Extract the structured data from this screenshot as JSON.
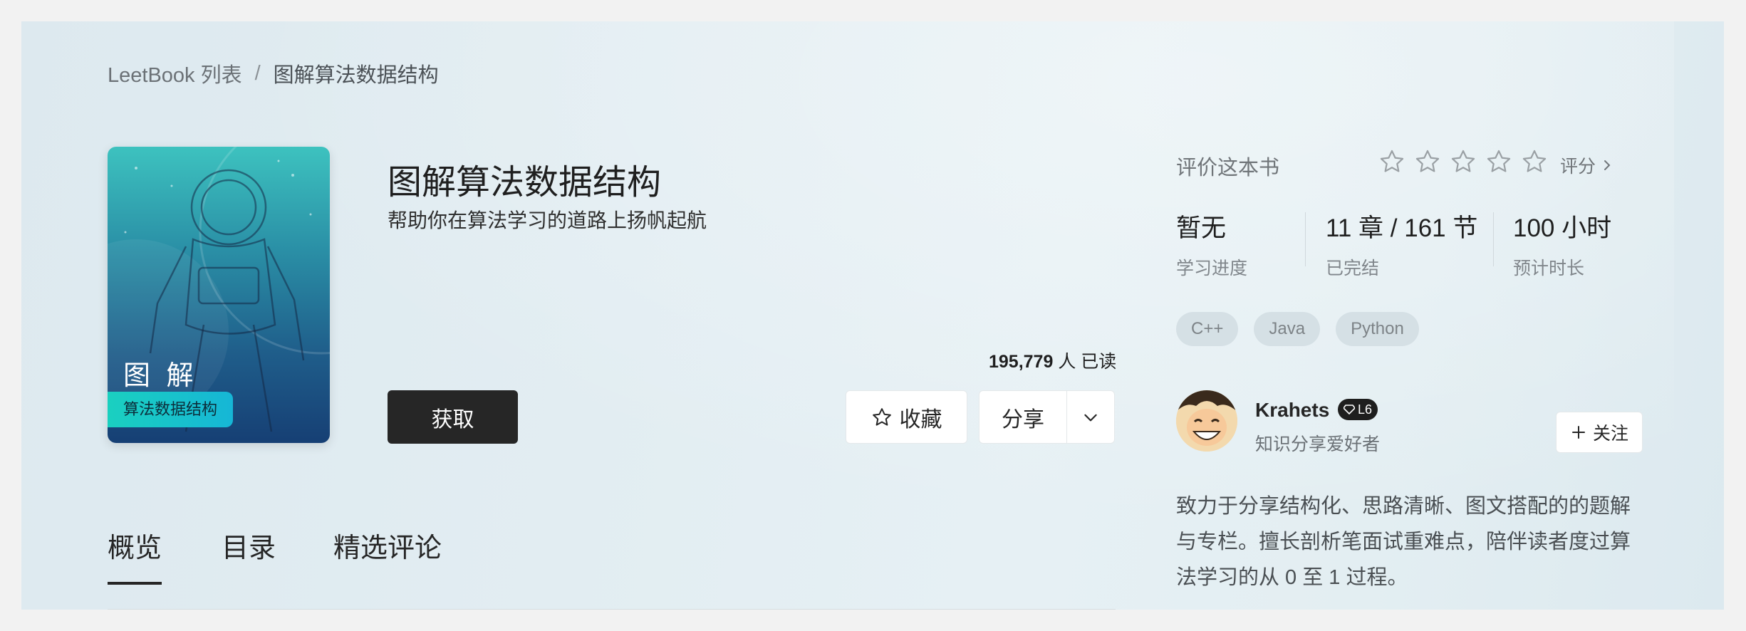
{
  "breadcrumb": {
    "root": "LeetBook 列表",
    "separator": "/",
    "current": "图解算法数据结构"
  },
  "book": {
    "cover_title": "图 解",
    "cover_tag": "算法数据结构",
    "title": "图解算法数据结构",
    "subtitle": "帮助你在算法学习的道路上扬帆起航",
    "readers_count": "195,779",
    "readers_suffix": "人 已读"
  },
  "actions": {
    "get_label": "获取",
    "favorite_label": "收藏",
    "share_label": "分享"
  },
  "tabs": [
    {
      "label": "概览",
      "active": true
    },
    {
      "label": "目录",
      "active": false
    },
    {
      "label": "精选评论",
      "active": false
    }
  ],
  "rating": {
    "label": "评价这本书",
    "star_count": 5,
    "filled": 0,
    "link_label": "评分"
  },
  "stats": [
    {
      "value": "暂无",
      "label": "学习进度"
    },
    {
      "value": "11 章 / 161 节",
      "label": "已完结"
    },
    {
      "value": "100 小时",
      "label": "预计时长"
    }
  ],
  "tags": [
    "C++",
    "Java",
    "Python"
  ],
  "author": {
    "name": "Krahets",
    "level": "L6",
    "role": "知识分享爱好者",
    "follow_label": "关注",
    "description": "致力于分享结构化、思路清晰、图文搭配的的题解与专栏。擅长剖析笔面试重难点，陪伴读者度过算法学习的从 0 至 1 过程。"
  },
  "colors": {
    "primary_button": "#262626",
    "cover_tag": "#1ad0c0",
    "panel": "#e2edf2"
  }
}
